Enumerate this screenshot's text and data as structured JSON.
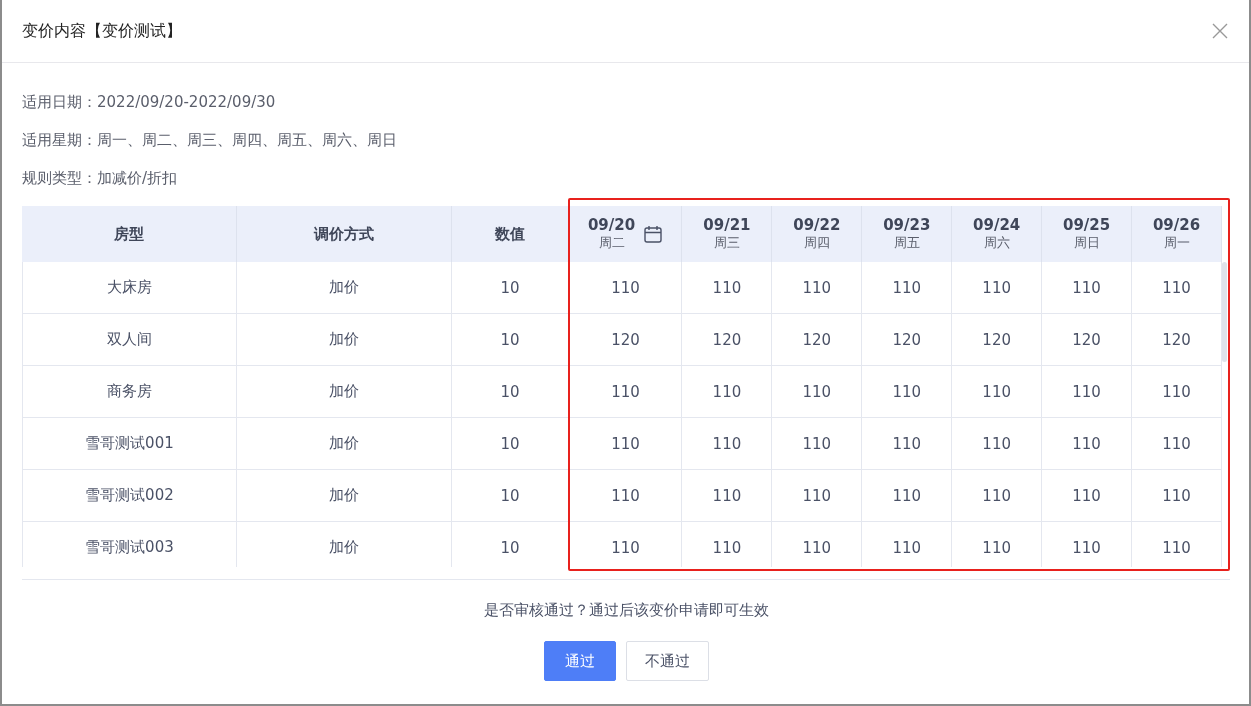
{
  "dialog": {
    "title": "变价内容【变价测试】"
  },
  "info": [
    {
      "label": "适用日期：",
      "value": "2022/09/20-2022/09/30"
    },
    {
      "label": "适用星期：",
      "value": "周一、周二、周三、周四、周五、周六、周日"
    },
    {
      "label": "规则类型：",
      "value": "加减价/折扣"
    }
  ],
  "table": {
    "columns": [
      "房型",
      "调价方式",
      "数值"
    ],
    "dates": [
      {
        "date": "09/20",
        "weekday": "周二",
        "calendar": true
      },
      {
        "date": "09/21",
        "weekday": "周三",
        "calendar": false
      },
      {
        "date": "09/22",
        "weekday": "周四",
        "calendar": false
      },
      {
        "date": "09/23",
        "weekday": "周五",
        "calendar": false
      },
      {
        "date": "09/24",
        "weekday": "周六",
        "calendar": false
      },
      {
        "date": "09/25",
        "weekday": "周日",
        "calendar": false
      },
      {
        "date": "09/26",
        "weekday": "周一",
        "calendar": false
      }
    ],
    "rows": [
      {
        "room": "大床房",
        "method": "加价",
        "value": "10",
        "prices": [
          "110",
          "110",
          "110",
          "110",
          "110",
          "110",
          "110"
        ]
      },
      {
        "room": "双人间",
        "method": "加价",
        "value": "10",
        "prices": [
          "120",
          "120",
          "120",
          "120",
          "120",
          "120",
          "120"
        ]
      },
      {
        "room": "商务房",
        "method": "加价",
        "value": "10",
        "prices": [
          "110",
          "110",
          "110",
          "110",
          "110",
          "110",
          "110"
        ]
      },
      {
        "room": "雪哥测试001",
        "method": "加价",
        "value": "10",
        "prices": [
          "110",
          "110",
          "110",
          "110",
          "110",
          "110",
          "110"
        ]
      },
      {
        "room": "雪哥测试002",
        "method": "加价",
        "value": "10",
        "prices": [
          "110",
          "110",
          "110",
          "110",
          "110",
          "110",
          "110"
        ]
      },
      {
        "room": "雪哥测试003",
        "method": "加价",
        "value": "10",
        "prices": [
          "110",
          "110",
          "110",
          "110",
          "110",
          "110",
          "110"
        ]
      }
    ]
  },
  "confirm": {
    "message": "是否审核通过？通过后该变价申请即可生效",
    "buttons": [
      {
        "label": "通过",
        "kind": "primary"
      },
      {
        "label": "不通过",
        "kind": "default"
      }
    ]
  }
}
